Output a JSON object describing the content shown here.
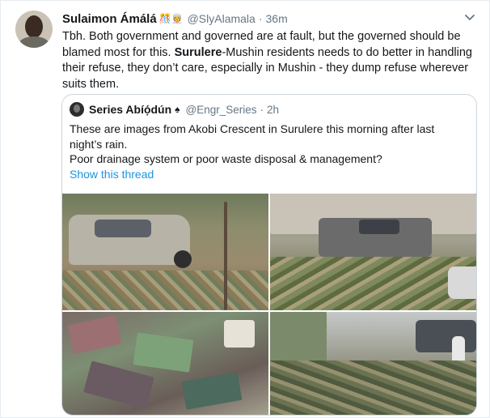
{
  "tweet": {
    "author_name": "Sulaimon Ámálá",
    "author_emoji": "🎊👳",
    "author_handle": "@SlyAlamala",
    "separator": "·",
    "time": "36m",
    "text_segments": {
      "a": "Tbh. Both government and governed are at fault, but the governed should be blamed most for this. ",
      "bold": "Surulere",
      "b": "-Mushin residents needs to do better in handling their refuse, they don’t care, especially in Mushin - they dump refuse wherever suits them."
    }
  },
  "quoted_tweet": {
    "author_name": "Series Abíọ́dún",
    "author_emoji": "♠",
    "author_handle": "@Engr_Series",
    "separator": "·",
    "time": "2h",
    "text_lines": [
      "These are images from Akobi Crescent in Surulere this morning after last night’s rain.",
      "Poor drainage system or poor waste disposal & management?"
    ],
    "show_thread": "Show this thread",
    "photos": [
      {
        "subject": "car-in-flooded-waste"
      },
      {
        "subject": "pickup-truck-in-waste"
      },
      {
        "subject": "plastic-waste-closeup"
      },
      {
        "subject": "street-covered-in-waste"
      }
    ]
  },
  "colors": {
    "link": "#1b95e0",
    "secondary_text": "#657786",
    "border": "#ccd6dd"
  },
  "icons": {
    "menu": "chevron-down-icon",
    "verified_style": "spade-icon"
  }
}
